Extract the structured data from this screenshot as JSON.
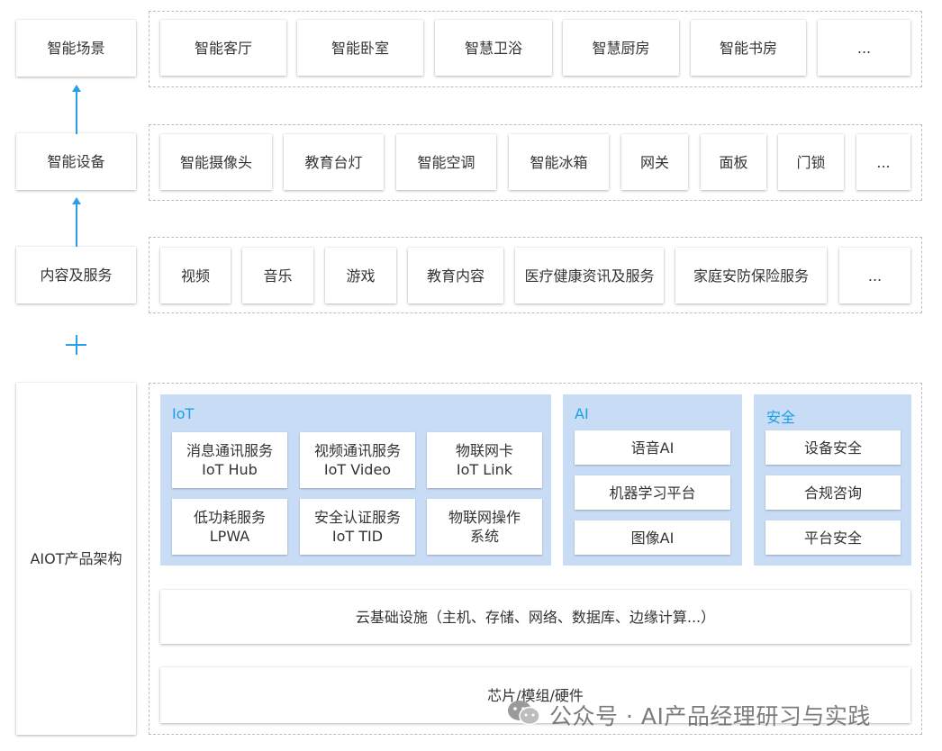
{
  "rows": {
    "scene": {
      "label": "智能场景",
      "items": [
        "智能客厅",
        "智能卧室",
        "智慧卫浴",
        "智慧厨房",
        "智能书房",
        "..."
      ]
    },
    "device": {
      "label": "智能设备",
      "items": [
        "智能摄像头",
        "教育台灯",
        "智能空调",
        "智能冰箱",
        "网关",
        "面板",
        "门锁",
        "..."
      ]
    },
    "content": {
      "label": "内容及服务",
      "items": [
        "视频",
        "音乐",
        "游戏",
        "教育内容",
        "医疗健康资讯及服务",
        "家庭安防保险服务",
        "..."
      ]
    }
  },
  "plus_symbol": "+",
  "aiot": {
    "label": "AIOT产品架构",
    "iot": {
      "title": "IoT",
      "services": [
        {
          "line1": "消息通讯服务",
          "line2": "IoT Hub"
        },
        {
          "line1": "视频通讯服务",
          "line2": "IoT Video"
        },
        {
          "line1": "物联网卡",
          "line2": "IoT Link"
        },
        {
          "line1": "低功耗服务",
          "line2": "LPWA"
        },
        {
          "line1": "安全认证服务",
          "line2": "IoT TID"
        },
        {
          "line1": "物联网操作",
          "line2": "系统"
        }
      ]
    },
    "ai": {
      "title": "AI",
      "items": [
        "语音AI",
        "机器学习平台",
        "图像AI"
      ]
    },
    "security": {
      "title": "安全",
      "items": [
        "设备安全",
        "合规咨询",
        "平台安全"
      ]
    },
    "cloud": "云基础设施（主机、存储、网络、数据库、边缘计算...）",
    "chip": "芯片/模组/硬件"
  },
  "watermark": {
    "text": "公众号 · AI产品经理研习与实践",
    "icon": "wechat-icon"
  },
  "colors": {
    "accent": "#2a9fe8",
    "panel_bg": "#c8dcf5",
    "title_blue": "#1aa0e8",
    "dash": "#bdbdbd"
  }
}
